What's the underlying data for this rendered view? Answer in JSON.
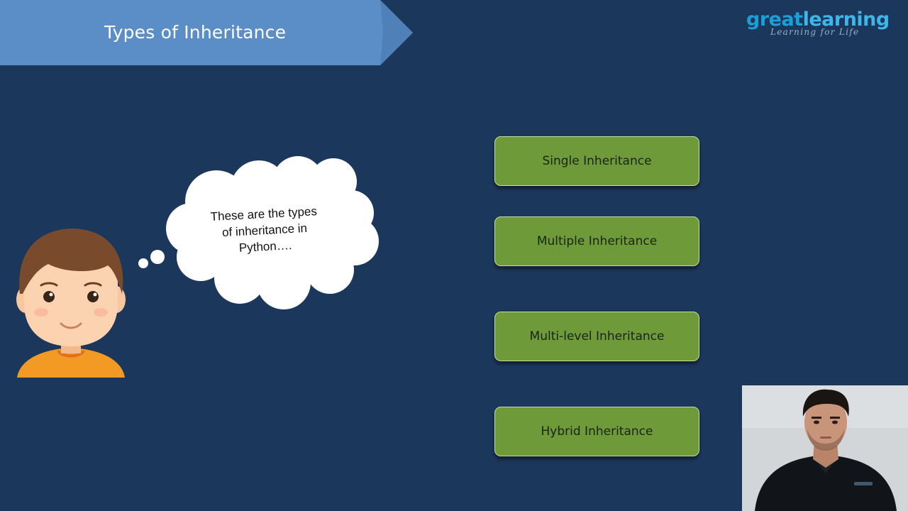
{
  "slide": {
    "title": "Types of Inheritance",
    "thought_text": "These are the types of inheritance in Python….",
    "inheritance_types": [
      "Single Inheritance",
      "Multiple Inheritance",
      "Multi-level Inheritance",
      "Hybrid Inheritance"
    ]
  },
  "logo": {
    "great": "great",
    "learning": "learning",
    "tagline": "Learning for Life"
  },
  "colors": {
    "background": "#1c375c",
    "banner": "#5b8ec6",
    "box_fill": "#6e9a3a",
    "box_border": "#c7dd9c",
    "logo_blue": "#1aa0d6"
  }
}
